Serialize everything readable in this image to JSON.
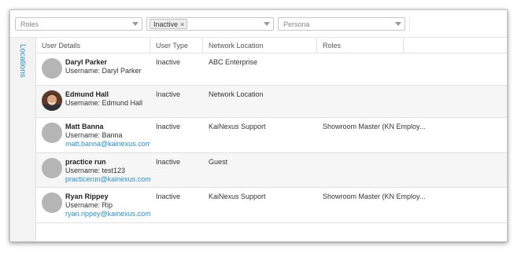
{
  "filters": {
    "roles_placeholder": "Roles",
    "status_tag": "Inactive",
    "status_tag_remove": "×",
    "persona_placeholder": "Persona"
  },
  "sidebar": {
    "tab_label": "Locations"
  },
  "table": {
    "columns": [
      "User Details",
      "User Type",
      "Network Location",
      "Roles"
    ],
    "rows": [
      {
        "name": "Daryl Parker",
        "username": "Username: Daryl Parker",
        "email": "",
        "type": "Inactive",
        "location": "ABC Enterprise",
        "roles": "",
        "avatar": "placeholder"
      },
      {
        "name": "Edmund Hall",
        "username": "Username: Edmund Hall",
        "email": "",
        "type": "Inactive",
        "location": "Network Location",
        "roles": "",
        "avatar": "photo"
      },
      {
        "name": "Matt Banna",
        "username": "Username: Banna",
        "email": "matt.banna@kainexus.com",
        "type": "Inactive",
        "location": "KaiNexus Support",
        "roles": "Showroom Master (KN Employ...",
        "avatar": "placeholder"
      },
      {
        "name": "practice run",
        "username": "Username: test123",
        "email": "practicerun@kainexus.com",
        "type": "Inactive",
        "location": "Guest",
        "roles": "",
        "avatar": "placeholder"
      },
      {
        "name": "Ryan Rippey",
        "username": "Username: Rip",
        "email": "ryan.rippey@kainexus.com",
        "type": "Inactive",
        "location": "KaiNexus Support",
        "roles": "Showroom Master (KN Employ...",
        "avatar": "placeholder"
      }
    ]
  },
  "colors": {
    "accent": "#2a8fc6",
    "avatar_placeholder": "#b5b5b5"
  }
}
